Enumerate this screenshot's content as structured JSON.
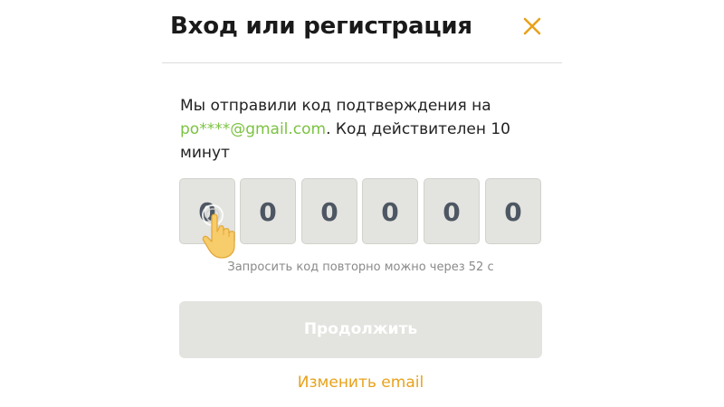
{
  "header": {
    "title": "Вход или регистрация",
    "close_icon": "close-icon"
  },
  "message": {
    "prefix": "Мы отправили код подтверждения на",
    "email": "po****@gmail.com",
    "suffix": ". Код действителен 10 минут"
  },
  "code": {
    "digits": [
      "0",
      "0",
      "0",
      "0",
      "0",
      "0"
    ]
  },
  "resend_text": "Запросить код повторно можно через 52 с",
  "continue_label": "Продолжить",
  "change_email_label": "Изменить email",
  "colors": {
    "accent": "#e8a21b",
    "email_link": "#7cc242",
    "disabled_button": "#e3e3df",
    "code_box": "#e3e3df"
  },
  "cursor_icon": "hand-pointer-icon"
}
